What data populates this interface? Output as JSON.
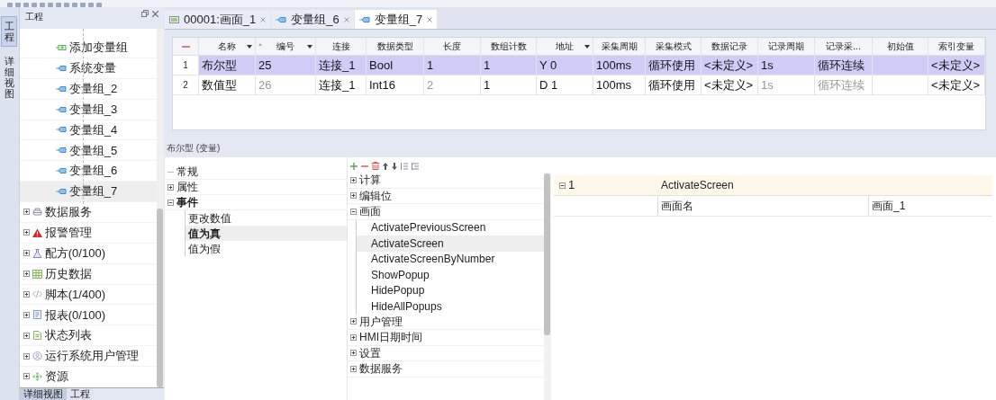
{
  "side_tabs": [
    {
      "label": "工程",
      "selected": true
    },
    {
      "label": "详细视图",
      "selected": false
    }
  ],
  "project_panel": {
    "title": "工程",
    "variable_groups": [
      {
        "label": "添加变量组",
        "kind": "add",
        "selected": false
      },
      {
        "label": "系统变量",
        "kind": "group",
        "selected": false
      },
      {
        "label": "变量组_2",
        "kind": "group",
        "selected": false
      },
      {
        "label": "变量组_3",
        "kind": "group",
        "selected": false
      },
      {
        "label": "变量组_4",
        "kind": "group",
        "selected": false
      },
      {
        "label": "变量组_5",
        "kind": "group",
        "selected": false
      },
      {
        "label": "变量组_6",
        "kind": "group",
        "selected": false
      },
      {
        "label": "变量组_7",
        "kind": "group",
        "selected": true
      }
    ],
    "sections": [
      {
        "label": "数据服务",
        "expanded": false
      },
      {
        "label": "报警管理",
        "expanded": false
      },
      {
        "label": "配方(0/100)",
        "expanded": false
      },
      {
        "label": "历史数据",
        "expanded": false
      },
      {
        "label": "脚本(1/400)",
        "expanded": false
      },
      {
        "label": "报表(0/100)",
        "expanded": false
      },
      {
        "label": "状态列表",
        "expanded": false
      },
      {
        "label": "运行系统用户管理",
        "expanded": false
      },
      {
        "label": "资源",
        "expanded": false
      }
    ],
    "bottom_tabs": [
      {
        "label": "详细视图",
        "selected": true
      },
      {
        "label": "工程",
        "selected": false
      }
    ]
  },
  "editor_tabs": [
    {
      "label": "00001:画面_1",
      "kind": "screen",
      "selected": false
    },
    {
      "label": "变量组_6",
      "kind": "group",
      "selected": false
    },
    {
      "label": "变量组_7",
      "kind": "group",
      "selected": true
    }
  ],
  "table": {
    "columns": [
      {
        "label": "名称",
        "filter": true,
        "sorted": false
      },
      {
        "label": "编号",
        "filter": true,
        "sorted": true
      },
      {
        "label": "连接",
        "filter": false,
        "sorted": false
      },
      {
        "label": "数据类型",
        "filter": false,
        "sorted": false
      },
      {
        "label": "长度",
        "filter": false,
        "sorted": false
      },
      {
        "label": "数组计数",
        "filter": false,
        "sorted": false
      },
      {
        "label": "地址",
        "filter": true,
        "sorted": false
      },
      {
        "label": "采集周期",
        "filter": false,
        "sorted": false
      },
      {
        "label": "采集模式",
        "filter": false,
        "sorted": false
      },
      {
        "label": "数据记录",
        "filter": false,
        "sorted": false
      },
      {
        "label": "记录周期",
        "filter": false,
        "sorted": false
      },
      {
        "label": "记录采...",
        "filter": false,
        "sorted": false
      },
      {
        "label": "初始值",
        "filter": false,
        "sorted": false
      },
      {
        "label": "索引变量",
        "filter": false,
        "sorted": false
      }
    ],
    "rows": [
      {
        "number": "1",
        "selected": true,
        "cells": [
          {
            "text": "布尔型",
            "dimmed": false
          },
          {
            "text": "25",
            "dimmed": false
          },
          {
            "text": "连接_1",
            "dimmed": false
          },
          {
            "text": "Bool",
            "dimmed": false
          },
          {
            "text": "1",
            "dimmed": false
          },
          {
            "text": "1",
            "dimmed": false
          },
          {
            "text": "Y 0",
            "dimmed": false
          },
          {
            "text": "100ms",
            "dimmed": false
          },
          {
            "text": "循环使用",
            "dimmed": false
          },
          {
            "text": "<未定义>",
            "dimmed": false
          },
          {
            "text": "1s",
            "dimmed": false
          },
          {
            "text": "循环连续",
            "dimmed": false
          },
          null,
          {
            "text": "<未定义>",
            "dimmed": false
          }
        ]
      },
      {
        "number": "2",
        "selected": false,
        "cells": [
          {
            "text": "数值型",
            "dimmed": false
          },
          {
            "text": "26",
            "dimmed": true
          },
          {
            "text": "连接_1",
            "dimmed": false
          },
          {
            "text": "Int16",
            "dimmed": false
          },
          {
            "text": "2",
            "dimmed": true
          },
          {
            "text": "1",
            "dimmed": false
          },
          {
            "text": "D 1",
            "dimmed": false
          },
          {
            "text": "100ms",
            "dimmed": false
          },
          {
            "text": "循环使用",
            "dimmed": false
          },
          {
            "text": "<未定义>",
            "dimmed": false
          },
          {
            "text": "1s",
            "dimmed": true
          },
          {
            "text": "循环连续",
            "dimmed": true
          },
          null,
          {
            "text": "<未定义>",
            "dimmed": false
          }
        ]
      }
    ]
  },
  "properties": {
    "caption": "布尔型 (变量)",
    "categories": [
      {
        "label": "常规",
        "kind": "leaf",
        "selected": false
      },
      {
        "label": "属性",
        "kind": "folder",
        "expanded": false,
        "selected": false
      },
      {
        "label": "事件",
        "kind": "folder",
        "expanded": true,
        "selected": true,
        "children": [
          {
            "label": "更改数值",
            "selected": false
          },
          {
            "label": "值为真",
            "selected": true
          },
          {
            "label": "值为假",
            "selected": false
          }
        ]
      }
    ]
  },
  "functions": {
    "categories": [
      {
        "label": "计算",
        "expanded": false
      },
      {
        "label": "编辑位",
        "expanded": false
      },
      {
        "label": "画面",
        "expanded": true,
        "children": [
          {
            "label": "ActivatePreviousScreen",
            "selected": false
          },
          {
            "label": "ActivateScreen",
            "selected": true
          },
          {
            "label": "ActivateScreenByNumber",
            "selected": false
          },
          {
            "label": "ShowPopup",
            "selected": false
          },
          {
            "label": "HidePopup",
            "selected": false
          },
          {
            "label": "HideAllPopups",
            "selected": false
          }
        ]
      },
      {
        "label": "用户管理",
        "expanded": false
      },
      {
        "label": "HMI日期时间",
        "expanded": false
      },
      {
        "label": "设置",
        "expanded": false
      },
      {
        "label": "数据服务",
        "expanded": false
      }
    ]
  },
  "function_list": [
    {
      "index": "1",
      "expanded": true,
      "name": "ActivateScreen",
      "parameters": [
        {
          "name": "画面名",
          "value": "画面_1"
        }
      ]
    }
  ]
}
